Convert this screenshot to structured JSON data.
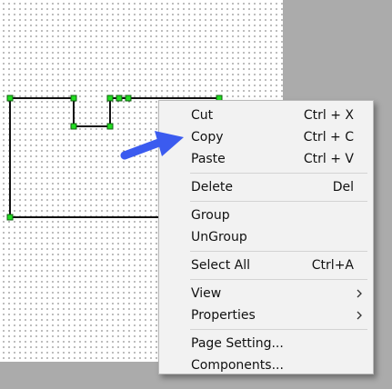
{
  "window": {
    "background": "#ababab",
    "canvas_background": "#ffffff"
  },
  "diagram": {
    "shape": "outline-shape",
    "handle_color": "#22dd22",
    "line_color": "#111111"
  },
  "context_menu": {
    "items": [
      {
        "label": "Cut",
        "shortcut": "Ctrl + X"
      },
      {
        "label": "Copy",
        "shortcut": "Ctrl + C"
      },
      {
        "label": "Paste",
        "shortcut": "Ctrl + V"
      },
      {
        "label": "Delete",
        "shortcut": "Del"
      },
      {
        "label": "Group",
        "shortcut": ""
      },
      {
        "label": "UnGroup",
        "shortcut": ""
      },
      {
        "label": "Select All",
        "shortcut": "Ctrl+A"
      },
      {
        "label": "View",
        "submenu": true
      },
      {
        "label": "Properties",
        "submenu": true
      },
      {
        "label": "Page Setting...",
        "shortcut": ""
      },
      {
        "label": "Components...",
        "shortcut": ""
      }
    ]
  },
  "pointer": {
    "icon": "blue-arrow-icon",
    "color": "#3b5bef"
  }
}
